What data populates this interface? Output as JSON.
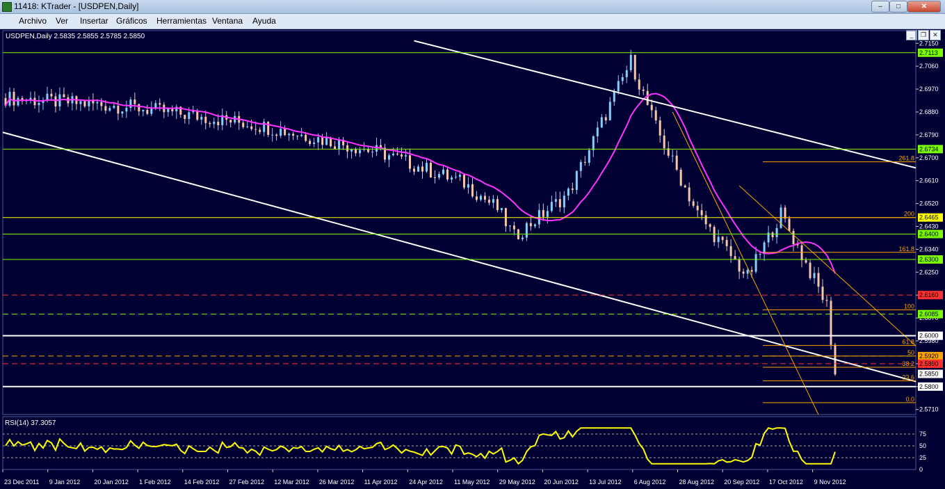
{
  "window": {
    "title": "11418: KTrader - [USDPEN,Daily]",
    "minimize": "–",
    "maximize": "□",
    "close": "✕"
  },
  "menu": [
    "Archivo",
    "Ver",
    "Insertar",
    "Gráficos",
    "Herramientas",
    "Ventana",
    "Ayuda"
  ],
  "mdi": {
    "minimize": "_",
    "restore": "❐",
    "close": "✕"
  },
  "chart": {
    "symbol_info": "USDPEN,Daily  2.5835 2.5855 2.5785 2.5850",
    "rsi_label": "RSI(14) 37.3057"
  },
  "colors": {
    "background": "#000033",
    "grid": "#1e3a8a",
    "candle_up": "#87cefa",
    "candle_down": "#f5c6b0",
    "moving_average": "#ff33ff",
    "channel": "#ffffff",
    "fibonacci": "#ffa500",
    "support_green": "#7cfc00",
    "resistance_red": "#ff3030",
    "rsi": "#ffff00"
  },
  "icons": {
    "app": "ktrader-app-icon"
  },
  "chart_data": {
    "type": "candlestick",
    "price_axis_ticks": [
      2.715,
      2.706,
      2.697,
      2.688,
      2.679,
      2.67,
      2.661,
      2.652,
      2.643,
      2.634,
      2.625,
      2.616,
      2.607,
      2.598,
      2.589,
      2.58,
      2.571
    ],
    "ylim": [
      2.569,
      2.72
    ],
    "x_tick_labels": [
      "23 Dec 2011",
      "9 Jan 2012",
      "20 Jan 2012",
      "1 Feb 2012",
      "14 Feb 2012",
      "27 Feb 2012",
      "12 Mar 2012",
      "26 Mar 2012",
      "11 Apr 2012",
      "24 Apr 2012",
      "11 May 2012",
      "29 May 2012",
      "20 Jun 2012",
      "13 Jul 2012",
      "6 Aug 2012",
      "28 Aug 2012",
      "20 Sep 2012",
      "17 Oct 2012",
      "9 Nov 2012"
    ],
    "last_bar": {
      "open": 2.5835,
      "high": 2.5855,
      "low": 2.5785,
      "close": 2.585
    },
    "horizontal_levels": [
      {
        "price": 2.7113,
        "label": "2.7113",
        "color": "#7cfc00",
        "style": "solid"
      },
      {
        "price": 2.6734,
        "label": "2.6734",
        "color": "#7cfc00",
        "style": "solid"
      },
      {
        "price": 2.6465,
        "label": "2.6465",
        "color": "#ffff00",
        "style": "solid"
      },
      {
        "price": 2.64,
        "label": "2.6400",
        "color": "#7cfc00",
        "style": "solid"
      },
      {
        "price": 2.63,
        "label": "2.6300",
        "color": "#7cfc00",
        "style": "solid"
      },
      {
        "price": 2.616,
        "label": "2.6160",
        "color": "#ff3030",
        "style": "dashed"
      },
      {
        "price": 2.6085,
        "label": "2.6085",
        "color": "#7cfc00",
        "style": "dashed"
      },
      {
        "price": 2.6,
        "label": "2.6000",
        "color": "#ffffff",
        "style": "solid"
      },
      {
        "price": 2.592,
        "label": "2.5920",
        "color": "#ffa500",
        "style": "dashed"
      },
      {
        "price": 2.589,
        "label": "2.5890",
        "color": "#ff3030",
        "style": "dashed"
      },
      {
        "price": 2.585,
        "label": "2.5850",
        "color": "#ffffff",
        "style": "marker"
      },
      {
        "price": 2.58,
        "label": "2.5800",
        "color": "#ffffff",
        "style": "solid"
      }
    ],
    "fibonacci_levels": [
      {
        "label": "261.8",
        "price": 2.6684
      },
      {
        "label": "200",
        "price": 2.6465
      },
      {
        "label": "161.8",
        "price": 2.6328
      },
      {
        "label": "100",
        "price": 2.6102
      },
      {
        "label": "61.8",
        "price": 2.5962
      },
      {
        "label": "50",
        "price": 2.592
      },
      {
        "label": "38.2",
        "price": 2.5876
      },
      {
        "label": "23.6",
        "price": 2.5823
      },
      {
        "label": "0.0",
        "price": 2.5737
      }
    ],
    "rsi": {
      "period": 14,
      "current": 37.3057,
      "levels": [
        75,
        50,
        25,
        0
      ],
      "ylim": [
        0,
        100
      ]
    }
  }
}
